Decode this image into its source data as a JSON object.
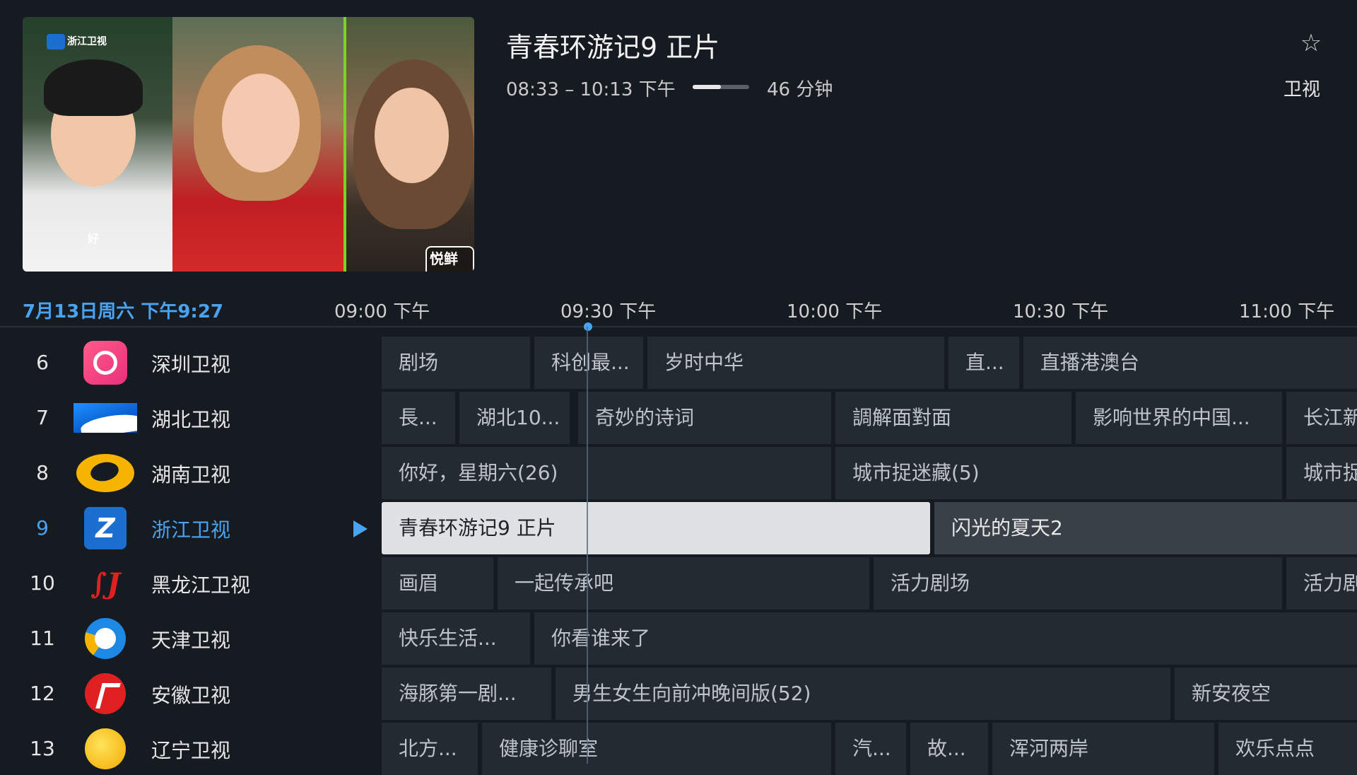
{
  "preview": {
    "channel_watermark": "浙江卫视",
    "caption_left": "好",
    "sticker": "悦鲜活"
  },
  "program": {
    "title": "青春环游记9 正片",
    "time_range": "08:33 – 10:13 下午",
    "progress": 0.5,
    "duration": "46 分钟",
    "category": "卫视",
    "favorite_icon": "star-outline-icon"
  },
  "timeline": {
    "datetime": "7月13日周六 下午9:27",
    "ticks": [
      "09:00 下午",
      "09:30 下午",
      "10:00 下午",
      "10:30 下午",
      "11:00 下午"
    ]
  },
  "channels": [
    {
      "num": "6",
      "name": "深圳卫视",
      "logo": "shenzhen-tv-logo",
      "programs": [
        "剧场",
        "科创最...",
        "岁时中华",
        "直...",
        "直播港澳台"
      ]
    },
    {
      "num": "7",
      "name": "湖北卫视",
      "logo": "hubei-tv-logo",
      "programs": [
        "長...",
        "湖北10...",
        "奇妙的诗词",
        "調解面對面",
        "影响世界的中国...",
        "长江新"
      ]
    },
    {
      "num": "8",
      "name": "湖南卫视",
      "logo": "hunan-tv-logo",
      "programs": [
        "你好，星期六(26)",
        "城市捉迷藏(5)",
        "城市捉"
      ]
    },
    {
      "num": "9",
      "name": "浙江卫视",
      "logo": "zhejiang-tv-logo",
      "active": true,
      "programs": [
        "青春环游记9 正片",
        "闪光的夏天2"
      ]
    },
    {
      "num": "10",
      "name": "黑龙江卫视",
      "logo": "heilongjiang-tv-logo",
      "programs": [
        "画眉",
        "一起传承吧",
        "活力剧场",
        "活力剧"
      ]
    },
    {
      "num": "11",
      "name": "天津卫视",
      "logo": "tianjin-tv-logo",
      "programs": [
        "快乐生活...",
        "你看谁来了"
      ]
    },
    {
      "num": "12",
      "name": "安徽卫视",
      "logo": "anhui-tv-logo",
      "programs": [
        "海豚第一剧...",
        "男生女生向前冲晚间版(52)",
        "新安夜空"
      ]
    },
    {
      "num": "13",
      "name": "辽宁卫视",
      "logo": "liaoning-tv-logo",
      "programs": [
        "北方...",
        "健康诊聊室",
        "汽...",
        "故...",
        "浑河两岸",
        "欢乐点点"
      ]
    }
  ]
}
